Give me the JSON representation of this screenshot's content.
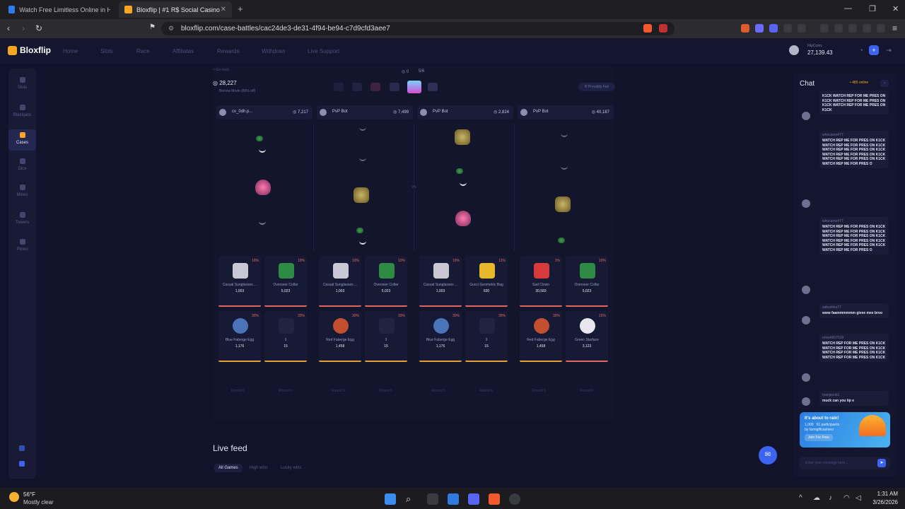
{
  "browser": {
    "tabs": [
      {
        "title": "Watch Free Limitless Online in HD - G",
        "active": false
      },
      {
        "title": "Bloxflip | #1 R$ Social Casino",
        "active": true
      }
    ],
    "url": "bloxflip.com/case-battles/cac24de3-de31-4f94-be94-c7d9cfd3aee7"
  },
  "site": {
    "logo_text": "Bloxflip",
    "nav": [
      "Home",
      "Slots",
      "Race",
      "Affiliates",
      "Rewards",
      "Withdraw",
      "Live Support"
    ],
    "user": {
      "label": "FlipCoins",
      "balance": "27,139.43"
    }
  },
  "sidebar": {
    "items": [
      {
        "label": "Slots",
        "active": false
      },
      {
        "label": "Blackjack",
        "active": false
      },
      {
        "label": "Cases",
        "active": true
      },
      {
        "label": "Dice",
        "active": false
      },
      {
        "label": "Mines",
        "active": false
      },
      {
        "label": "Towers",
        "active": false
      },
      {
        "label": "Plinko",
        "active": false
      }
    ]
  },
  "battle": {
    "back_label": "< Go back",
    "total_value": "28,227",
    "borrow_label": "Borrow Mode (80% off)",
    "round_count": "0",
    "round_progress": "5/6",
    "fair_label": "Provably Fair",
    "vs_label": "VS",
    "players": [
      {
        "name": "cv_0dh.p...",
        "amount": "7,217"
      },
      {
        "name": "PvP Bot",
        "amount": "7,499"
      },
      {
        "name": "PvP Bot",
        "amount": "2,824"
      },
      {
        "name": "PvP Bot",
        "amount": "40,187"
      }
    ],
    "items_row1": [
      {
        "pct": "10%",
        "name": "Casual Sunglasses ...",
        "price": "1,003",
        "color": "#c8c8d4"
      },
      {
        "pct": "10%",
        "name": "Overseer Collar",
        "price": "5,023",
        "color": "#2f8a44"
      },
      {
        "pct": "10%",
        "name": "Casual Sunglasses ...",
        "price": "1,003",
        "color": "#c8c8d4"
      },
      {
        "pct": "10%",
        "name": "Overseer Collar",
        "price": "5,023",
        "color": "#2f8a44"
      },
      {
        "pct": "10%",
        "name": "Casual Sunglasses ...",
        "price": "1,003",
        "color": "#c8c8d4"
      },
      {
        "pct": "11%",
        "name": "Gucci Geometric Bag",
        "price": "630",
        "color": "#e6b82a"
      },
      {
        "pct": "1%",
        "name": "Sad Clown",
        "price": "30,583",
        "color": "#d63a3a"
      },
      {
        "pct": "10%",
        "name": "Overseer Collar",
        "price": "5,023",
        "color": "#2f8a44"
      }
    ],
    "items_row2": [
      {
        "pct": "30%",
        "name": "Blue Faberge Egg",
        "price": "1,176",
        "color": "#4b73b8"
      },
      {
        "pct": "30%",
        "name": "3",
        "price": "15",
        "color": "#22243f"
      },
      {
        "pct": "30%",
        "name": "Red Faberge Egg",
        "price": "1,458",
        "color": "#c2502e"
      },
      {
        "pct": "30%",
        "name": "3",
        "price": "15",
        "color": "#22243f"
      },
      {
        "pct": "30%",
        "name": "Blue Faberge Egg",
        "price": "1,176",
        "color": "#4b73b8"
      },
      {
        "pct": "30%",
        "name": "3",
        "price": "15",
        "color": "#22243f"
      },
      {
        "pct": "30%",
        "name": "Red Faberge Egg",
        "price": "1,458",
        "color": "#c2502e"
      },
      {
        "pct": "15%",
        "name": "Green Starface",
        "price": "3,123",
        "color": "#e6e6ee"
      }
    ],
    "round_labels": [
      "Round 5",
      "Round 6",
      "Round 5",
      "Round 6",
      "Round 5",
      "Round 6",
      "Round 5",
      "Round 6"
    ]
  },
  "live_feed": {
    "title": "Live feed",
    "tabs": [
      {
        "label": "All Games",
        "active": true
      },
      {
        "label": "High wins",
        "active": false
      },
      {
        "label": "Lucky wins",
        "active": false
      }
    ]
  },
  "chat": {
    "title": "Chat",
    "online": "485 online",
    "messages": [
      {
        "user": "",
        "text": "K1CK WATCH REP FOR ME PRES ON K1CK WATCH REP FOR ME PRES ON K1CK WATCH REP FOR ME PRES ON K1CK"
      },
      {
        "user": "whocares#77",
        "text": "WATCH REP ME FOR PRES ON K1CK WATCH REP ME FOR PRES ON K1CK WATCH REP ME FOR PRES ON K1CK WATCH REP ME FOR PRES ON K1CK WATCH REP ME FOR PRES ON K1CK WATCH REP ME FOR PRES O"
      },
      {
        "user": "whocares#77",
        "text": "WATCH REP ME FOR PRES ON K1CK WATCH REP ME FOR PRES ON K1CK WATCH REP ME FOR PRES ON K1CK WATCH REP ME FOR PRES ON K1CK WATCH REP ME FOR PRES ON K1CK WATCH REP ME FOR PRES O"
      },
      {
        "user": "sabushka77",
        "text": "www faammmmmm givee mee broo"
      },
      {
        "user": "orisa4607639",
        "text": "WATCH REP FOR ME PRES ON K1CK WATCH REP FOR ME PRES ON K1CK WATCH REP FOR ME PRES ON K1CK WATCH REP FOR ME PRES ON K1CK"
      },
      {
        "user": "ryanjacob1",
        "text": "muck can you tip e"
      }
    ],
    "rain": {
      "title": "It's about to rain!",
      "amount": "1,000",
      "participants": "61 participants",
      "by": "by farmgiftcashero",
      "button": "Join For Free"
    },
    "input_placeholder": "Enter your message here..."
  },
  "taskbar": {
    "temp": "56°F",
    "condition": "Mostly clear",
    "time": "1:31 AM",
    "date": "3/26/2026"
  }
}
